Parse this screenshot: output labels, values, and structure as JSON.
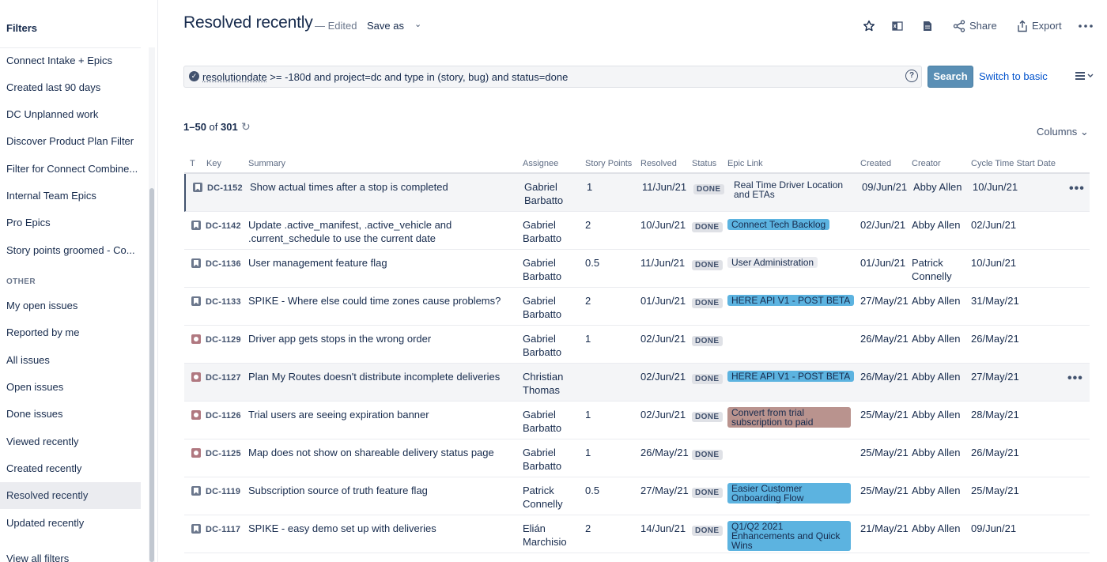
{
  "sidebar": {
    "title": "Filters",
    "items": [
      {
        "label": "Connect Intake + Epics"
      },
      {
        "label": "Created last 90 days"
      },
      {
        "label": "DC Unplanned work"
      },
      {
        "label": "Discover Product Plan Filter"
      },
      {
        "label": "Filter for Connect Combine..."
      },
      {
        "label": "Internal Team Epics"
      },
      {
        "label": "Pro Epics"
      },
      {
        "label": "Story points groomed - Co..."
      }
    ],
    "other_label": "OTHER",
    "other_items": [
      {
        "label": "My open issues"
      },
      {
        "label": "Reported by me"
      },
      {
        "label": "All issues"
      },
      {
        "label": "Open issues"
      },
      {
        "label": "Done issues"
      },
      {
        "label": "Viewed recently"
      },
      {
        "label": "Created recently"
      },
      {
        "label": "Resolved recently"
      },
      {
        "label": "Updated recently"
      }
    ],
    "view_all": "View all filters"
  },
  "header": {
    "title": "Resolved recently",
    "edited": "— Edited",
    "save_as": "Save as",
    "share": "Share",
    "export": "Export"
  },
  "search": {
    "jql_keyword": "resolutiondate",
    "jql_rest": " >= -180d and project=dc and type in (story, bug) and status=done",
    "button": "Search",
    "switch": "Switch to basic"
  },
  "results": {
    "range": "1–50",
    "of": " of ",
    "total": "301",
    "columns_label": "Columns"
  },
  "table": {
    "headers": {
      "t": "T",
      "key": "Key",
      "summary": "Summary",
      "assignee": "Assignee",
      "story_points": "Story Points",
      "resolved": "Resolved",
      "status": "Status",
      "epic": "Epic Link",
      "created": "Created",
      "creator": "Creator",
      "cycle": "Cycle Time Start Date"
    },
    "rows": [
      {
        "type": "story",
        "key": "DC-1152",
        "summary1": "Show actual times after a stop is completed",
        "summary2": "",
        "assignee1": "Gabriel",
        "assignee2": "Barbatto",
        "points": "1",
        "resolved": "11/Jun/21",
        "status": "DONE",
        "epic1": "Real Time Driver Location",
        "epic2": "and ETAs",
        "epic_color": "none",
        "created": "09/Jun/21",
        "creator1": "Abby Allen",
        "creator2": "",
        "cycle": "10/Jun/21"
      },
      {
        "type": "story",
        "key": "DC-1142",
        "summary1": "Update .active_manifest, .active_vehicle and",
        "summary2": ".current_schedule to use the current date",
        "assignee1": "Gabriel",
        "assignee2": "Barbatto",
        "points": "2",
        "resolved": "10/Jun/21",
        "status": "DONE",
        "epic1": "Connect Tech Backlog",
        "epic2": "",
        "epic_color": "blue",
        "created": "02/Jun/21",
        "creator1": "Abby Allen",
        "creator2": "",
        "cycle": "02/Jun/21"
      },
      {
        "type": "story",
        "key": "DC-1136",
        "summary1": "User management feature flag",
        "summary2": "",
        "assignee1": "Gabriel",
        "assignee2": "Barbatto",
        "points": "0.5",
        "resolved": "11/Jun/21",
        "status": "DONE",
        "epic1": "User Administration",
        "epic2": "",
        "epic_color": "grey",
        "created": "01/Jun/21",
        "creator1": "Patrick",
        "creator2": "Connelly",
        "cycle": "10/Jun/21"
      },
      {
        "type": "story",
        "key": "DC-1133",
        "summary1": "SPIKE - Where else could time zones cause problems?",
        "summary2": "",
        "assignee1": "Gabriel",
        "assignee2": "Barbatto",
        "points": "2",
        "resolved": "01/Jun/21",
        "status": "DONE",
        "epic1": "HERE API V1 - POST BETA",
        "epic2": "",
        "epic_color": "blue",
        "created": "27/May/21",
        "creator1": "Abby Allen",
        "creator2": "",
        "cycle": "31/May/21"
      },
      {
        "type": "bug",
        "key": "DC-1129",
        "summary1": "Driver app gets stops in the wrong order",
        "summary2": "",
        "assignee1": "Gabriel",
        "assignee2": "Barbatto",
        "points": "1",
        "resolved": "02/Jun/21",
        "status": "DONE",
        "epic1": "",
        "epic2": "",
        "epic_color": "none",
        "created": "26/May/21",
        "creator1": "Abby Allen",
        "creator2": "",
        "cycle": "26/May/21"
      },
      {
        "type": "bug",
        "key": "DC-1127",
        "summary1": "Plan My Routes doesn't distribute incomplete deliveries",
        "summary2": "",
        "assignee1": "Christian",
        "assignee2": "Thomas",
        "points": "",
        "resolved": "02/Jun/21",
        "status": "DONE",
        "epic1": "HERE API V1 - POST BETA",
        "epic2": "",
        "epic_color": "blue",
        "created": "26/May/21",
        "creator1": "Abby Allen",
        "creator2": "",
        "cycle": "27/May/21"
      },
      {
        "type": "bug",
        "key": "DC-1126",
        "summary1": "Trial users are seeing expiration banner",
        "summary2": "",
        "assignee1": "Gabriel",
        "assignee2": "Barbatto",
        "points": "1",
        "resolved": "02/Jun/21",
        "status": "DONE",
        "epic1": "Convert from trial",
        "epic2": "subscription to paid",
        "epic_color": "rose",
        "created": "25/May/21",
        "creator1": "Abby Allen",
        "creator2": "",
        "cycle": "28/May/21"
      },
      {
        "type": "bug",
        "key": "DC-1125",
        "summary1": "Map does not show on shareable delivery status page",
        "summary2": "",
        "assignee1": "Gabriel",
        "assignee2": "Barbatto",
        "points": "1",
        "resolved": "26/May/21",
        "status": "DONE",
        "epic1": "",
        "epic2": "",
        "epic_color": "none",
        "created": "25/May/21",
        "creator1": "Abby Allen",
        "creator2": "",
        "cycle": "26/May/21"
      },
      {
        "type": "story",
        "key": "DC-1119",
        "summary1": "Subscription source of truth feature flag",
        "summary2": "",
        "assignee1": "Patrick",
        "assignee2": "Connelly",
        "points": "0.5",
        "resolved": "27/May/21",
        "status": "DONE",
        "epic1": "Easier Customer",
        "epic2": "Onboarding Flow",
        "epic_color": "blue",
        "created": "25/May/21",
        "creator1": "Abby Allen",
        "creator2": "",
        "cycle": "25/May/21"
      },
      {
        "type": "story",
        "key": "DC-1117",
        "summary1": "SPIKE - easy demo set up with deliveries",
        "summary2": "",
        "assignee1": "Elián",
        "assignee2": "Marchisio",
        "points": "2",
        "resolved": "14/Jun/21",
        "status": "DONE",
        "epic1": "Q1/Q2 2021",
        "epic2": "Enhancements and Quick",
        "epic3": "Wins",
        "epic_color": "blue",
        "created": "21/May/21",
        "creator1": "Abby Allen",
        "creator2": "",
        "cycle": "09/Jun/21"
      }
    ]
  }
}
